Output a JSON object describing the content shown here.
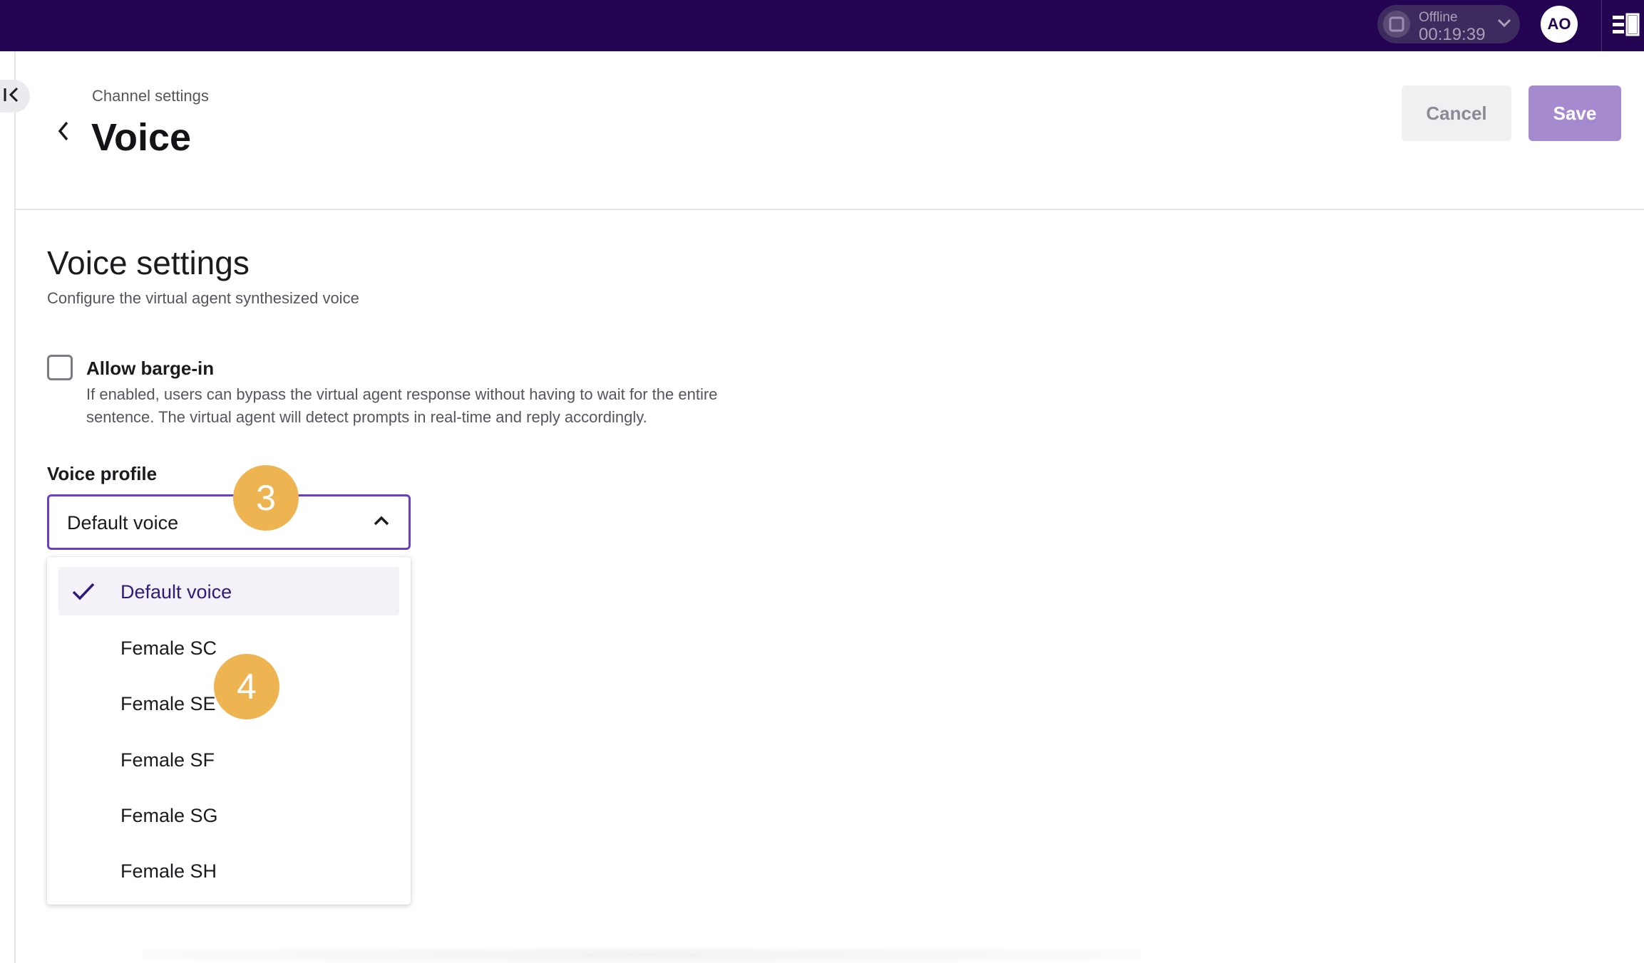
{
  "topbar": {
    "status_label": "Offline",
    "status_timer": "00:19:39",
    "avatar_initials": "AO",
    "background_color": "#240352"
  },
  "header": {
    "breadcrumb": "Channel settings",
    "title": "Voice",
    "cancel_label": "Cancel",
    "save_label": "Save"
  },
  "voice_settings": {
    "title": "Voice settings",
    "subtitle": "Configure the virtual agent synthesized voice",
    "barge_in": {
      "label": "Allow barge-in",
      "checked": false,
      "help_line_1": "If enabled, users can bypass the virtual agent response without having to wait for the entire",
      "help_line_2": "sentence. The virtual agent will detect prompts in real-time and reply accordingly."
    },
    "voice_profile": {
      "label": "Voice profile",
      "selected": "Default voice",
      "options": [
        {
          "label": "Default voice",
          "selected": true
        },
        {
          "label": "Female SC",
          "selected": false
        },
        {
          "label": "Female SE",
          "selected": false
        },
        {
          "label": "Female SF",
          "selected": false
        },
        {
          "label": "Female SG",
          "selected": false
        },
        {
          "label": "Female SH",
          "selected": false
        }
      ]
    }
  },
  "annotations": {
    "step_a": "3",
    "step_b": "4",
    "color": "#efb452"
  },
  "colors": {
    "accent": "#6a3fc4",
    "save_button": "#a68ad0"
  },
  "icons": {
    "status": "stop-icon",
    "status_menu": "chevron-down-icon",
    "panel": "panel-toggle-icon",
    "collapse": "collapse-left-icon",
    "back": "chevron-left-icon",
    "select": "chevron-up-icon",
    "selected_option": "check-icon"
  }
}
